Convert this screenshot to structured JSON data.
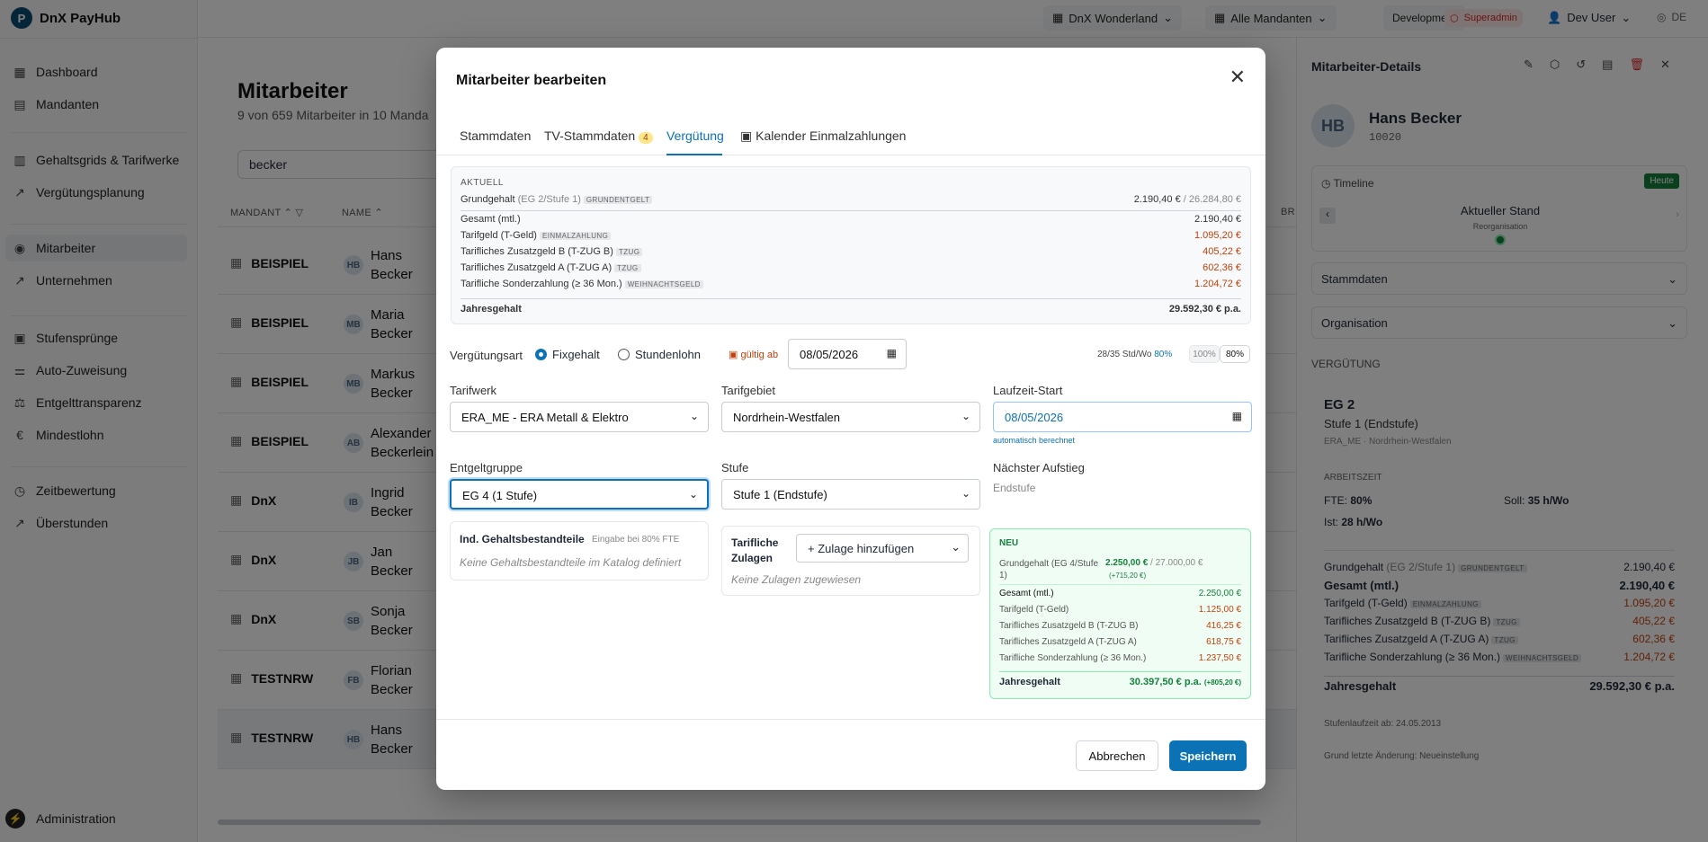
{
  "app": {
    "name": "DnX PayHub",
    "logo_letter": "P"
  },
  "sidebar": {
    "items": [
      {
        "label": "Dashboard",
        "icon": "grid-icon"
      },
      {
        "label": "Mandanten",
        "icon": "building-icon"
      },
      {
        "label": "Gehaltsgrids & Tarifwerke",
        "icon": "document-icon"
      },
      {
        "label": "Vergütungsplanung",
        "icon": "trend-icon"
      },
      {
        "label": "Mitarbeiter",
        "icon": "user-icon",
        "active": true
      },
      {
        "label": "Unternehmen",
        "icon": "trend-icon"
      },
      {
        "label": "Stufensprünge",
        "icon": "calendar-icon"
      },
      {
        "label": "Auto-Zuweisung",
        "icon": "sliders-icon"
      },
      {
        "label": "Entgelttransparenz",
        "icon": "scale-icon"
      },
      {
        "label": "Mindestlohn",
        "icon": "euro-icon"
      },
      {
        "label": "Zeitbewertung",
        "icon": "clock-icon"
      },
      {
        "label": "Überstunden",
        "icon": "trend-icon"
      }
    ],
    "admin": "Administration"
  },
  "topbar": {
    "company": "DnX Wonderland",
    "mandanten": "Alle Mandanten",
    "env": "Development",
    "role": "Superadmin",
    "user": "Dev User",
    "lang": "DE"
  },
  "main": {
    "title": "Mitarbeiter",
    "subtitle": "9 von 659 Mitarbeiter in 10 Manda",
    "search_value": "becker",
    "columns": {
      "mandant": "MANDANT",
      "name": "NAME",
      "br": "BR"
    },
    "rows": [
      {
        "mandant": "BEISPIEL",
        "initials": "HB",
        "first": "Hans",
        "last": "Becker"
      },
      {
        "mandant": "BEISPIEL",
        "initials": "MB",
        "first": "Maria",
        "last": "Becker"
      },
      {
        "mandant": "BEISPIEL",
        "initials": "MB",
        "first": "Markus",
        "last": "Becker"
      },
      {
        "mandant": "BEISPIEL",
        "initials": "AB",
        "first": "Alexander",
        "last": "Beckerlein"
      },
      {
        "mandant": "DnX",
        "initials": "IB",
        "first": "Ingrid",
        "last": "Becker"
      },
      {
        "mandant": "DnX",
        "initials": "JB",
        "first": "Jan",
        "last": "Becker"
      },
      {
        "mandant": "DnX",
        "initials": "SB",
        "first": "Sonja",
        "last": "Becker"
      },
      {
        "mandant": "TESTNRW",
        "initials": "FB",
        "first": "Florian",
        "last": "Becker"
      },
      {
        "mandant": "TESTNRW",
        "initials": "HB",
        "first": "Hans",
        "last": "Becker"
      }
    ]
  },
  "details": {
    "title": "Mitarbeiter-Details",
    "initials": "HB",
    "name": "Hans Becker",
    "id": "10020",
    "timeline": "Timeline",
    "heute": "Heute",
    "stand": "Aktueller Stand",
    "stand_sub": "Reorganisation",
    "stammdaten": "Stammdaten",
    "organisation": "Organisation",
    "verguetung": "VERGÜTUNG",
    "eg": "EG 2",
    "stufe": "Stufe 1 (Endstufe)",
    "tarif": "ERA_ME · Nordrhein-Westfalen",
    "arbeitszeit": "ARBEITSZEIT",
    "fte_l": "FTE:",
    "fte_v": "80%",
    "soll_l": "Soll:",
    "soll_v": "35 h/Wo",
    "ist_l": "Ist:",
    "ist_v": "28 h/Wo",
    "lines": [
      {
        "label": "Grundgehalt",
        "extra": "(EG 2/Stufe 1)",
        "tag": "GRUNDENTGELT",
        "value": "2.190,40 €",
        "style": "normal"
      },
      {
        "label": "Gesamt (mtl.)",
        "extra": "",
        "tag": "",
        "value": "2.190,40 €",
        "style": "bold"
      },
      {
        "label": "Tarifgeld (T-Geld)",
        "extra": "",
        "tag": "EINMALZAHLUNG",
        "value": "1.095,20 €",
        "style": "orange"
      },
      {
        "label": "Tarifliches Zusatzgeld B (T-ZUG B)",
        "extra": "",
        "tag": "TZUG",
        "value": "405,22 €",
        "style": "orange"
      },
      {
        "label": "Tarifliches Zusatzgeld A (T-ZUG A)",
        "extra": "",
        "tag": "TZUG",
        "value": "602,36 €",
        "style": "orange"
      },
      {
        "label": "Tarifliche Sonderzahlung (≥ 36 Mon.)",
        "extra": "",
        "tag": "WEIHNACHTSGELD",
        "value": "1.204,72 €",
        "style": "orange"
      }
    ],
    "jahres_l": "Jahresgehalt",
    "jahres_v": "29.592,30 € p.a.",
    "stufenlaufzeit": "Stufenlaufzeit ab: 24.05.2013",
    "grund": "Grund letzte Änderung: Neueinstellung"
  },
  "modal": {
    "title": "Mitarbeiter bearbeiten",
    "tabs": {
      "t1": "Stammdaten",
      "t2": "TV-Stammdaten",
      "t2_count": "4",
      "t3": "Vergütung",
      "t4": "Kalender Einmalzahlungen"
    },
    "aktuell": {
      "header": "AKTUELL",
      "grund_label": "Grundgehalt",
      "grund_extra": "(EG 2/Stufe 1)",
      "grund_tag": "GRUNDENTGELT",
      "grund_value": "2.190,40 €",
      "grund_year": "/ 26.284,80 €",
      "lines": [
        {
          "label": "Gesamt (mtl.)",
          "tag": "",
          "value": "2.190,40 €",
          "orange": false
        },
        {
          "label": "Tarifgeld (T-Geld)",
          "tag": "EINMALZAHLUNG",
          "value": "1.095,20 €",
          "orange": true
        },
        {
          "label": "Tarifliches Zusatzgeld B (T-ZUG B)",
          "tag": "TZUG",
          "value": "405,22 €",
          "orange": true
        },
        {
          "label": "Tarifliches Zusatzgeld A (T-ZUG A)",
          "tag": "TZUG",
          "value": "602,36 €",
          "orange": true
        },
        {
          "label": "Tarifliche Sonderzahlung (≥ 36 Mon.)",
          "tag": "WEIHNACHTSGELD",
          "value": "1.204,72 €",
          "orange": true
        }
      ],
      "jahres_label": "Jahresgehalt",
      "jahres_value": "29.592,30 € p.a."
    },
    "verguetungsart": "Vergütungsart",
    "fixgehalt": "Fixgehalt",
    "stundenlohn": "Stundenlohn",
    "gueltig_ab": "gültig ab",
    "gueltig_date": "08/05/2026",
    "hours": "28/35 Std/Wo",
    "hours_pct": "80%",
    "btn100": "100%",
    "btn80": "80%",
    "tarifwerk_l": "Tarifwerk",
    "tarifwerk_v": "ERA_ME - ERA Metall & Elektro",
    "tarifgebiet_l": "Tarifgebiet",
    "tarifgebiet_v": "Nordrhein-Westfalen",
    "laufzeit_l": "Laufzeit-Start",
    "laufzeit_v": "08/05/2026",
    "auto": "automatisch berechnet",
    "entgelt_l": "Entgeltgruppe",
    "entgelt_v": "EG 4 (1 Stufe)",
    "stufe_l": "Stufe",
    "stufe_v": "Stufe 1 (Endstufe)",
    "naechster_l": "Nächster Aufstieg",
    "naechster_v": "Endstufe",
    "ind_l": "Ind. Gehaltsbestandteile",
    "ind_hint": "Eingabe bei 80% FTE",
    "ind_empty": "Keine Gehaltsbestandteile im Katalog definiert",
    "zul_l": "Tarifliche Zulagen",
    "zul_btn": "+ Zulage hinzufügen",
    "zul_empty": "Keine Zulagen zugewiesen",
    "neu": {
      "header": "NEU",
      "grund_label": "Grundgehalt (EG 4/Stufe 1)",
      "grund_value": "2.250,00 €",
      "grund_year": "/ 27.000,00 €",
      "grund_delta": "(+715,20 €)",
      "lines": [
        {
          "label": "Gesamt (mtl.)",
          "value": "2.250,00 €",
          "style": "green"
        },
        {
          "label": "Tarifgeld (T-Geld)",
          "value": "1.125,00 €",
          "style": "orange"
        },
        {
          "label": "Tarifliches Zusatzgeld B (T-ZUG B)",
          "value": "416,25 €",
          "style": "orange"
        },
        {
          "label": "Tarifliches Zusatzgeld A (T-ZUG A)",
          "value": "618,75 €",
          "style": "orange"
        },
        {
          "label": "Tarifliche Sonderzahlung (≥ 36 Mon.)",
          "value": "1.237,50 €",
          "style": "orange"
        }
      ],
      "jahres_label": "Jahresgehalt",
      "jahres_value": "30.397,50 € p.a.",
      "jahres_delta": "(+805,20 €)"
    },
    "cancel": "Abbrechen",
    "save": "Speichern"
  }
}
